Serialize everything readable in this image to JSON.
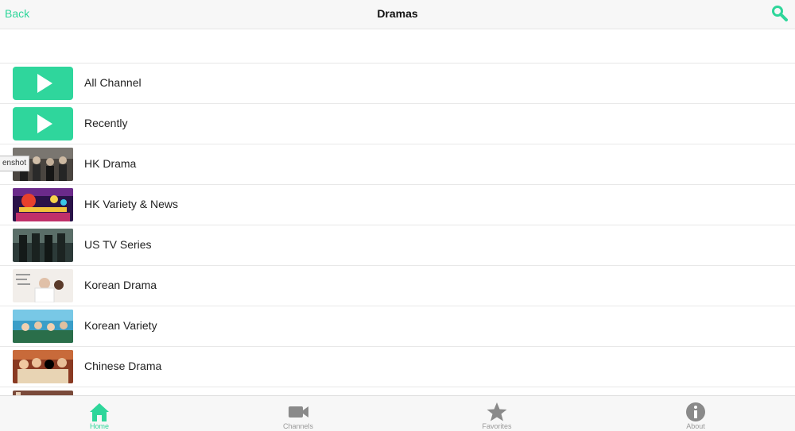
{
  "navbar": {
    "back_label": "Back",
    "title": "Dramas",
    "search_icon": "search-icon"
  },
  "tooltip": {
    "text": "enshot"
  },
  "list": {
    "items": [
      {
        "label": "All Channel",
        "thumb": "play-icon"
      },
      {
        "label": "Recently",
        "thumb": "play-icon"
      },
      {
        "label": "HK Drama",
        "thumb": "image"
      },
      {
        "label": "HK Variety & News",
        "thumb": "image"
      },
      {
        "label": "US TV Series",
        "thumb": "image"
      },
      {
        "label": "Korean Drama",
        "thumb": "image"
      },
      {
        "label": "Korean Variety",
        "thumb": "image"
      },
      {
        "label": "Chinese Drama",
        "thumb": "image"
      }
    ]
  },
  "tabbar": {
    "tabs": [
      {
        "label": "Home",
        "icon": "home-icon",
        "active": true
      },
      {
        "label": "Channels",
        "icon": "video-camera-icon",
        "active": false
      },
      {
        "label": "Favorites",
        "icon": "star-icon",
        "active": false
      },
      {
        "label": "About",
        "icon": "info-icon",
        "active": false
      }
    ]
  },
  "colors": {
    "accent": "#2ed69a",
    "inactive": "#8a8a8a",
    "play_tile": "#2fd69c"
  }
}
